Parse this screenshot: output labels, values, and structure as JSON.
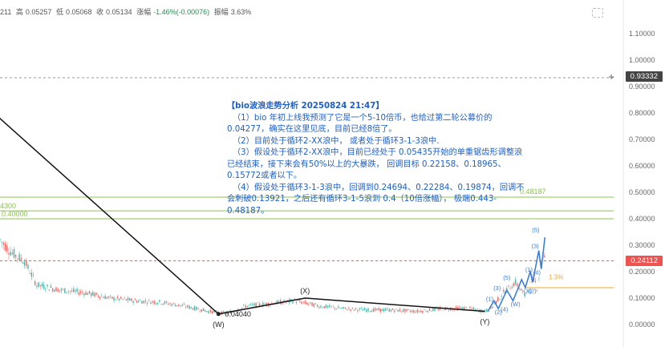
{
  "header": {
    "code": "211",
    "high_label": "高",
    "high": "0.05257",
    "low_label": "低",
    "low": "0.05068",
    "close_label": "收",
    "close": "0.05134",
    "change_label": "涨幅",
    "change": "-1.46%(-0.00076)",
    "amplitude_label": "振幅",
    "amplitude": "3.63%"
  },
  "annotation": {
    "title": "【bio波浪走势分析 20250824 21:47】",
    "lines": [
      "（1）bio 年初上线我预测了它是一个5-10倍币，也给过第二轮公募价的0.04277，确实在这里见底，目前已经8倍了。",
      "（2）目前处于循环2-XX浪中， 或者处于循环3-1-3浪中.",
      "（3）假设处于循环2-XX浪中，目前已经处于 0.05435开始的单重锯齿形调整浪已经结束，接下来会有50%以上的大暴跌， 回调目标 0.22158、0.18965、0.15772或者以下。",
      "（4）假设处于循环3-1-3浪中，回调到0.24694、0.22284、0.19874，回调不会刺破0.13921，之后还有循环3-1-5浪到 0.4（10倍涨幅）， 极端0.443-0.48187。"
    ]
  },
  "price_tags": {
    "crosshair": "0.93332",
    "last": "0.24112"
  },
  "level_labels": {
    "l48187": "0.48187",
    "l40000": "0.40000",
    "l4300": "4300",
    "l13921": "0.13921",
    "low_label": "0.04040"
  },
  "colors": {
    "candle_up": "#26a69a",
    "candle_down": "#ef5350",
    "green_line": "#8bc34a",
    "orange_line": "#f5a623",
    "wave_blue": "#3d7fd4",
    "annotation": "#1f5fc4",
    "last_price": "#ef5350",
    "crosshair_tag": "#444444"
  },
  "chart_data": {
    "type": "line",
    "y_axis": {
      "ticks": [
        "0.00000",
        "0.10000",
        "0.20000",
        "0.30000",
        "0.40000",
        "0.50000",
        "0.60000",
        "0.70000",
        "0.80000",
        "0.90000",
        "1.00000",
        "1.10000"
      ],
      "ylim": [
        -0.02,
        1.2
      ]
    },
    "horizontal_levels": [
      {
        "value": 0.48187,
        "color": "green"
      },
      {
        "value": 0.43,
        "color": "green"
      },
      {
        "value": 0.4,
        "color": "green"
      },
      {
        "value": 0.13921,
        "color": "orange"
      },
      {
        "value": 0.24112,
        "color": "red-dashed"
      },
      {
        "value": 0.93332,
        "color": "gray-dashed"
      }
    ],
    "price_series_ohlc_summary": {
      "high": 0.05257,
      "low": 0.05068,
      "close": 0.05134
    },
    "price_trace": [
      {
        "x": 0.0,
        "y": 0.32
      },
      {
        "x": 0.02,
        "y": 0.27
      },
      {
        "x": 0.04,
        "y": 0.24
      },
      {
        "x": 0.06,
        "y": 0.15
      },
      {
        "x": 0.1,
        "y": 0.13
      },
      {
        "x": 0.14,
        "y": 0.12
      },
      {
        "x": 0.18,
        "y": 0.1
      },
      {
        "x": 0.22,
        "y": 0.09
      },
      {
        "x": 0.26,
        "y": 0.085
      },
      {
        "x": 0.3,
        "y": 0.07
      },
      {
        "x": 0.34,
        "y": 0.05
      },
      {
        "x": 0.37,
        "y": 0.042
      },
      {
        "x": 0.4,
        "y": 0.07
      },
      {
        "x": 0.44,
        "y": 0.08
      },
      {
        "x": 0.48,
        "y": 0.09
      },
      {
        "x": 0.52,
        "y": 0.07
      },
      {
        "x": 0.56,
        "y": 0.06
      },
      {
        "x": 0.6,
        "y": 0.055
      },
      {
        "x": 0.64,
        "y": 0.055
      },
      {
        "x": 0.68,
        "y": 0.05
      },
      {
        "x": 0.72,
        "y": 0.06
      },
      {
        "x": 0.76,
        "y": 0.062
      },
      {
        "x": 0.79,
        "y": 0.05
      },
      {
        "x": 0.8,
        "y": 0.06
      },
      {
        "x": 0.82,
        "y": 0.12
      },
      {
        "x": 0.84,
        "y": 0.16
      },
      {
        "x": 0.855,
        "y": 0.11
      },
      {
        "x": 0.87,
        "y": 0.18
      },
      {
        "x": 0.875,
        "y": 0.14
      },
      {
        "x": 0.885,
        "y": 0.27
      },
      {
        "x": 0.89,
        "y": 0.24
      }
    ],
    "wave_line": [
      {
        "x": -0.01,
        "y": 0.8
      },
      {
        "x": 0.356,
        "y": 0.04
      },
      {
        "x": 0.497,
        "y": 0.1
      },
      {
        "x": 0.79,
        "y": 0.05
      }
    ],
    "wave_labels": [
      {
        "text": "(W)",
        "x": 0.356,
        "y": 0.04,
        "pos": "below"
      },
      {
        "text": "(X)",
        "x": 0.497,
        "y": 0.1,
        "pos": "above"
      },
      {
        "text": "(Y)",
        "x": 0.79,
        "y": 0.05,
        "pos": "below"
      }
    ],
    "blue_waves": [
      {
        "x": 0.795,
        "y": 0.05
      },
      {
        "x": 0.805,
        "y": 0.09
      },
      {
        "x": 0.812,
        "y": 0.06
      },
      {
        "x": 0.826,
        "y": 0.13
      },
      {
        "x": 0.836,
        "y": 0.09
      },
      {
        "x": 0.85,
        "y": 0.17
      },
      {
        "x": 0.856,
        "y": 0.14
      },
      {
        "x": 0.864,
        "y": 0.2
      },
      {
        "x": 0.868,
        "y": 0.16
      },
      {
        "x": 0.878,
        "y": 0.28
      },
      {
        "x": 0.882,
        "y": 0.21
      },
      {
        "x": 0.888,
        "y": 0.33
      }
    ],
    "blue_labels": [
      {
        "text": "(1)",
        "x": 0.798,
        "y": 0.09
      },
      {
        "text": "(2)",
        "x": 0.812,
        "y": 0.04
      },
      {
        "text": "(3)",
        "x": 0.81,
        "y": 0.13
      },
      {
        "text": "(4)",
        "x": 0.822,
        "y": 0.05
      },
      {
        "text": "(5)",
        "x": 0.826,
        "y": 0.17
      },
      {
        "text": "(W)",
        "x": 0.84,
        "y": 0.07
      },
      {
        "text": "(X)",
        "x": 0.86,
        "y": 0.12
      },
      {
        "text": "(1)",
        "x": 0.862,
        "y": 0.2
      },
      {
        "text": "(2)",
        "x": 0.868,
        "y": 0.12
      },
      {
        "text": "(3)",
        "x": 0.872,
        "y": 0.29
      },
      {
        "text": "(4)",
        "x": 0.875,
        "y": 0.19
      },
      {
        "text": "(5)",
        "x": 0.873,
        "y": 0.35
      }
    ],
    "fib_marker": "1.3%"
  }
}
